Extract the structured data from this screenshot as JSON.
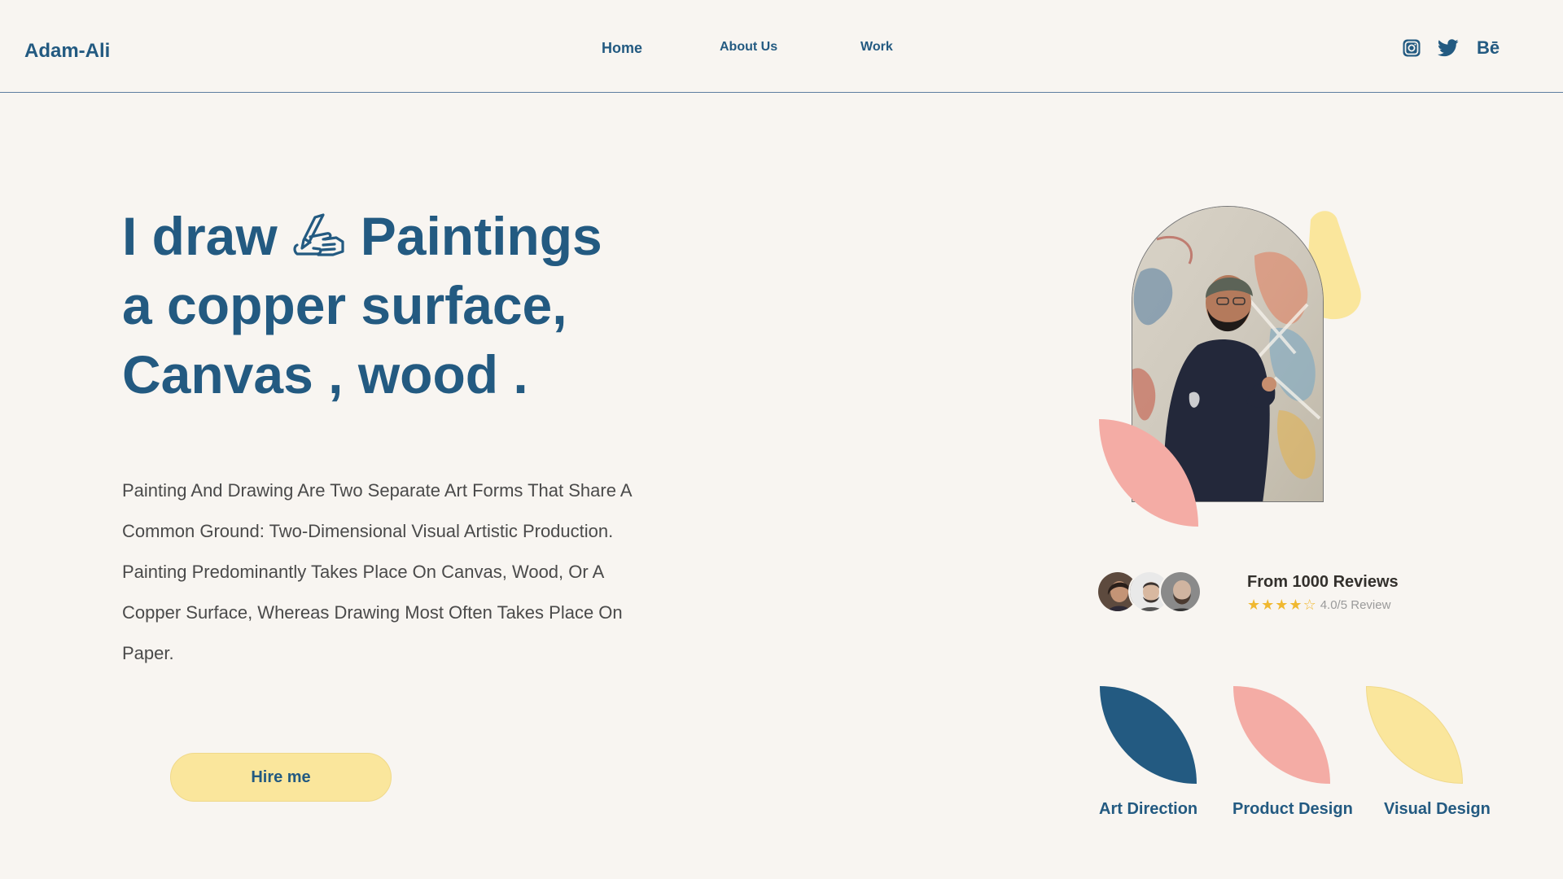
{
  "header": {
    "logo": "Adam-Ali",
    "nav": [
      {
        "label": "Home"
      },
      {
        "label": "About Us"
      },
      {
        "label": "Work"
      }
    ],
    "social": {
      "instagram": "instagram-icon",
      "twitter": "twitter-icon",
      "behance_label": "Bē"
    }
  },
  "hero": {
    "title_line1_a": "I draw",
    "title_line1_b": "Paintings",
    "title_line2": "a copper surface,",
    "title_line3": "Canvas , wood .",
    "title_icon": "writing-hand-icon",
    "description": "Painting And Drawing Are Two Separate Art Forms That Share A Common Ground: Two-Dimensional Visual Artistic Production. Painting Predominantly Takes Place On Canvas, Wood, Or A Copper Surface, Whereas Drawing Most Often Takes Place On Paper.",
    "cta_label": "Hire me"
  },
  "reviews": {
    "title": "From 1000 Reviews",
    "rating": 4,
    "rating_max": 5,
    "rating_text": "4.0/5 Review"
  },
  "services": [
    {
      "label": "Art Direction",
      "color": "#235a81"
    },
    {
      "label": "Product Design",
      "color": "#f4aca5"
    },
    {
      "label": "Visual Design",
      "color": "#fae69c"
    }
  ],
  "colors": {
    "primary": "#235a81",
    "background": "#f8f5f1",
    "pink": "#f4aca5",
    "yellow": "#fae69c",
    "star": "#f0b830"
  }
}
